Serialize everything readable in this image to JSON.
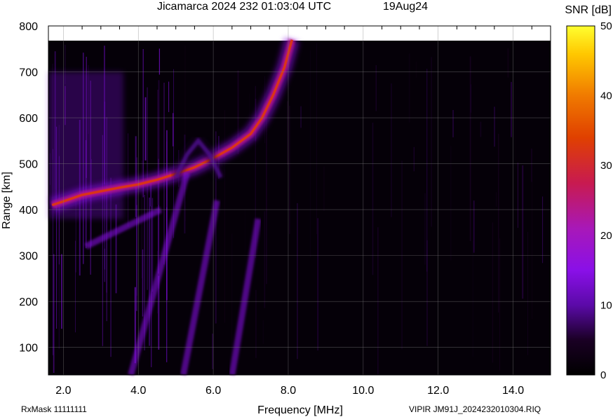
{
  "chart_data": {
    "type": "heatmap",
    "title": "Jicamarca 2024 232 01:03:04 UTC",
    "date": "19Aug24",
    "xlabel": "Frequency [MHz]",
    "ylabel": "Range [km]",
    "xlim": [
      1.6,
      15.0
    ],
    "ylim": [
      40,
      800
    ],
    "x_ticks": [
      "2.0",
      "4.0",
      "6.0",
      "8.0",
      "10.0",
      "12.0",
      "14.0"
    ],
    "x_tick_values": [
      2,
      4,
      6,
      8,
      10,
      12,
      14
    ],
    "y_ticks": [
      "100",
      "200",
      "300",
      "400",
      "500",
      "600",
      "700",
      "800"
    ],
    "y_tick_values": [
      100,
      200,
      300,
      400,
      500,
      600,
      700,
      800
    ],
    "colorbar": {
      "label": "SNR [dB]",
      "range": [
        0,
        50
      ],
      "ticks": [
        "0",
        "10",
        "20",
        "30",
        "40",
        "50"
      ],
      "tick_values": [
        0,
        10,
        20,
        30,
        40,
        50
      ]
    },
    "grid": true,
    "traces": [
      {
        "x": [
          1.7,
          2.0,
          2.5,
          3.0,
          3.5,
          4.0,
          4.5,
          5.0,
          5.5,
          6.0,
          6.5,
          7.0,
          7.3,
          7.6,
          7.9,
          8.1
        ],
        "y": [
          410,
          418,
          432,
          440,
          448,
          455,
          465,
          478,
          492,
          512,
          535,
          565,
          600,
          650,
          710,
          770
        ],
        "peak_db": 32
      },
      {
        "x": [
          5.0,
          5.3,
          5.6,
          5.9,
          6.2
        ],
        "y": [
          470,
          520,
          550,
          520,
          470
        ],
        "peak_db": 12
      }
    ]
  },
  "footer": {
    "left": "RxMask 11111111",
    "right": "VIPIR  JM91J_2024232010304.RIQ"
  }
}
